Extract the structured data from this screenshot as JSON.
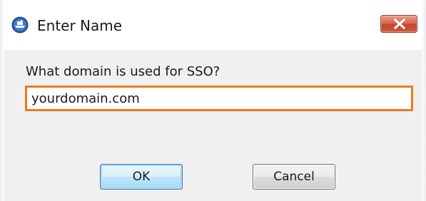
{
  "window": {
    "title": "Enter Name",
    "title_icon": "app-icon",
    "close_icon": "close-icon"
  },
  "dialog": {
    "prompt": "What domain is used for SSO?",
    "input_value": "yourdomain.com",
    "input_placeholder": "",
    "ok_label": "OK",
    "cancel_label": "Cancel"
  },
  "colors": {
    "input_focus_border": "#f07a1a",
    "close_button": "#c2452a",
    "dialog_background": "#f0f0f0"
  }
}
